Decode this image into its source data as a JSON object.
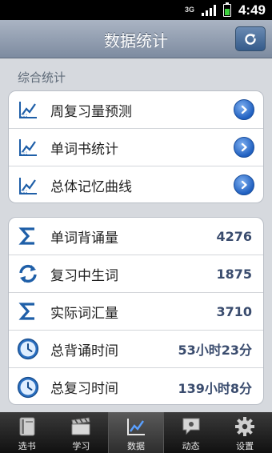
{
  "status_bar": {
    "network": "3G",
    "time": "4:49"
  },
  "header": {
    "title": "数据统计"
  },
  "section": {
    "label": "综合统计"
  },
  "links": [
    {
      "label": "周复习量预测",
      "icon": "chart-line-icon"
    },
    {
      "label": "单词书统计",
      "icon": "chart-line-icon"
    },
    {
      "label": "总体记忆曲线",
      "icon": "chart-line-icon"
    }
  ],
  "stats": [
    {
      "label": "单词背诵量",
      "value": "4276",
      "icon": "sigma-icon"
    },
    {
      "label": "复习中生词",
      "value": "1875",
      "icon": "refresh-arrows-icon"
    },
    {
      "label": "实际词汇量",
      "value": "3710",
      "icon": "sigma-icon"
    },
    {
      "label": "总背诵时间",
      "value": "53小时23分",
      "icon": "clock-icon"
    },
    {
      "label": "总复习时间",
      "value": "139小时8分",
      "icon": "clock-icon"
    }
  ],
  "tabs": [
    {
      "label": "选书",
      "icon": "book-icon"
    },
    {
      "label": "学习",
      "icon": "clapperboard-icon"
    },
    {
      "label": "数据",
      "icon": "chart-line-icon",
      "active": true
    },
    {
      "label": "动态",
      "icon": "chat-bubble-icon"
    },
    {
      "label": "设置",
      "icon": "gear-icon"
    }
  ]
}
